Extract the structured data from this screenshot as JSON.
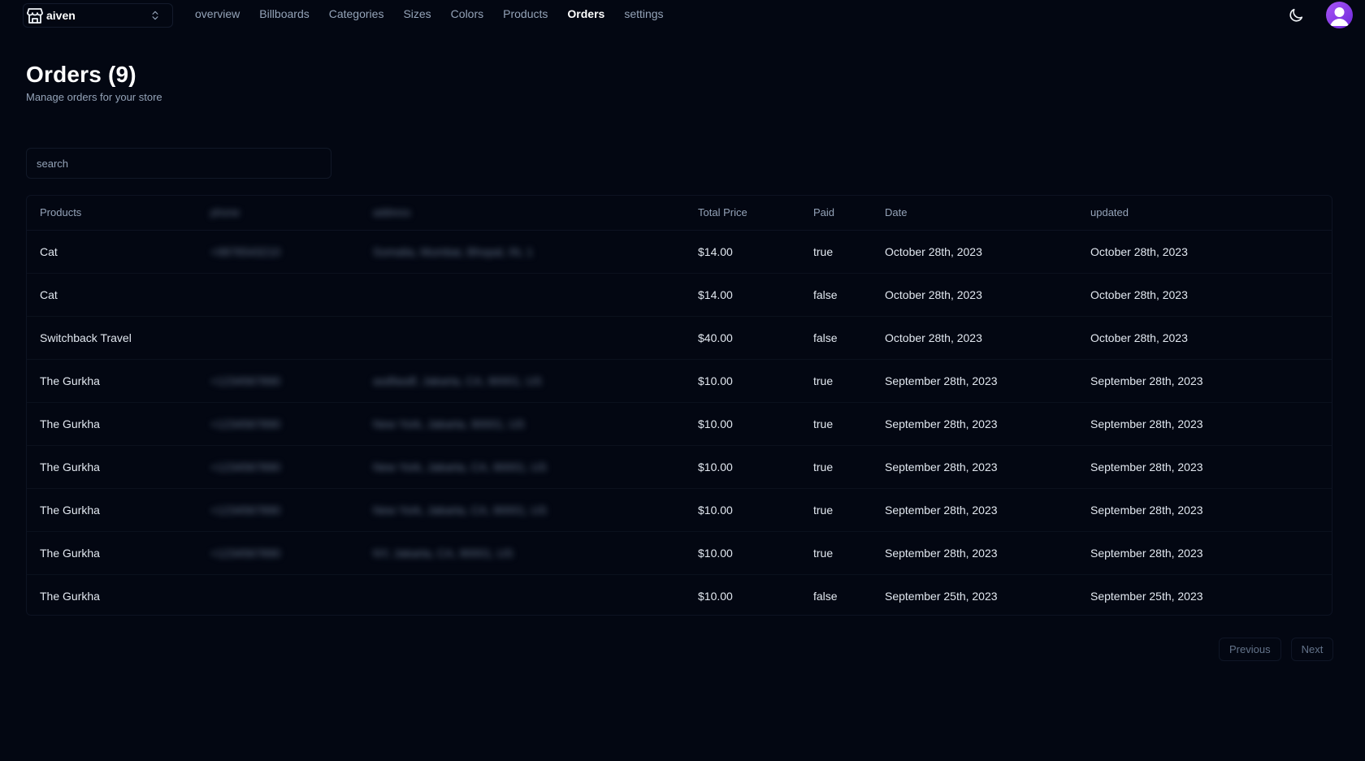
{
  "store": {
    "name": "aiven",
    "icon": "store-icon"
  },
  "nav": [
    {
      "label": "overview",
      "active": false
    },
    {
      "label": "Billboards",
      "active": false
    },
    {
      "label": "Categories",
      "active": false
    },
    {
      "label": "Sizes",
      "active": false
    },
    {
      "label": "Colors",
      "active": false
    },
    {
      "label": "Products",
      "active": false
    },
    {
      "label": "Orders",
      "active": true
    },
    {
      "label": "settings",
      "active": false
    }
  ],
  "page": {
    "title": "Orders (9)",
    "description": "Manage orders for your store"
  },
  "search": {
    "placeholder": "search"
  },
  "table": {
    "columns": [
      "Products",
      "phone",
      "address",
      "Total Price",
      "Paid",
      "Date",
      "updated"
    ],
    "rows": [
      {
        "product": "Cat",
        "phone": "+9876543210",
        "address": "Somalia, Mumbai, Bhopal, IN, 1",
        "price": "$14.00",
        "paid": "true",
        "date": "October 28th, 2023",
        "updated": "October 28th, 2023"
      },
      {
        "product": "Cat",
        "phone": "",
        "address": "",
        "price": "$14.00",
        "paid": "false",
        "date": "October 28th, 2023",
        "updated": "October 28th, 2023"
      },
      {
        "product": "Switchback Travel",
        "phone": "",
        "address": "",
        "price": "$40.00",
        "paid": "false",
        "date": "October 28th, 2023",
        "updated": "October 28th, 2023"
      },
      {
        "product": "The Gurkha",
        "phone": "+1234567890",
        "address": "asdfasdf, Jakarta, CA, 90001, US",
        "price": "$10.00",
        "paid": "true",
        "date": "September 28th, 2023",
        "updated": "September 28th, 2023"
      },
      {
        "product": "The Gurkha",
        "phone": "+1234567890",
        "address": "New York, Jakarta, 90001, US",
        "price": "$10.00",
        "paid": "true",
        "date": "September 28th, 2023",
        "updated": "September 28th, 2023"
      },
      {
        "product": "The Gurkha",
        "phone": "+1234567890",
        "address": "New York, Jakarta, CA, 90001, US",
        "price": "$10.00",
        "paid": "true",
        "date": "September 28th, 2023",
        "updated": "September 28th, 2023"
      },
      {
        "product": "The Gurkha",
        "phone": "+1234567890",
        "address": "New York, Jakarta, CA, 90001, US",
        "price": "$10.00",
        "paid": "true",
        "date": "September 28th, 2023",
        "updated": "September 28th, 2023"
      },
      {
        "product": "The Gurkha",
        "phone": "+1234567890",
        "address": "NY, Jakarta, CA, 90001, US",
        "price": "$10.00",
        "paid": "true",
        "date": "September 28th, 2023",
        "updated": "September 28th, 2023"
      },
      {
        "product": "The Gurkha",
        "phone": "",
        "address": "",
        "price": "$10.00",
        "paid": "false",
        "date": "September 25th, 2023",
        "updated": "September 25th, 2023"
      }
    ]
  },
  "pagination": {
    "previous": "Previous",
    "next": "Next"
  },
  "icons": {
    "theme": "moon-icon",
    "avatar": "user-avatar-icon",
    "chevron": "chevrons-up-down-icon"
  },
  "colors": {
    "background": "#030712",
    "text": "#f1f5f9",
    "muted": "#94a3b8",
    "avatar": "#7c3aed"
  }
}
